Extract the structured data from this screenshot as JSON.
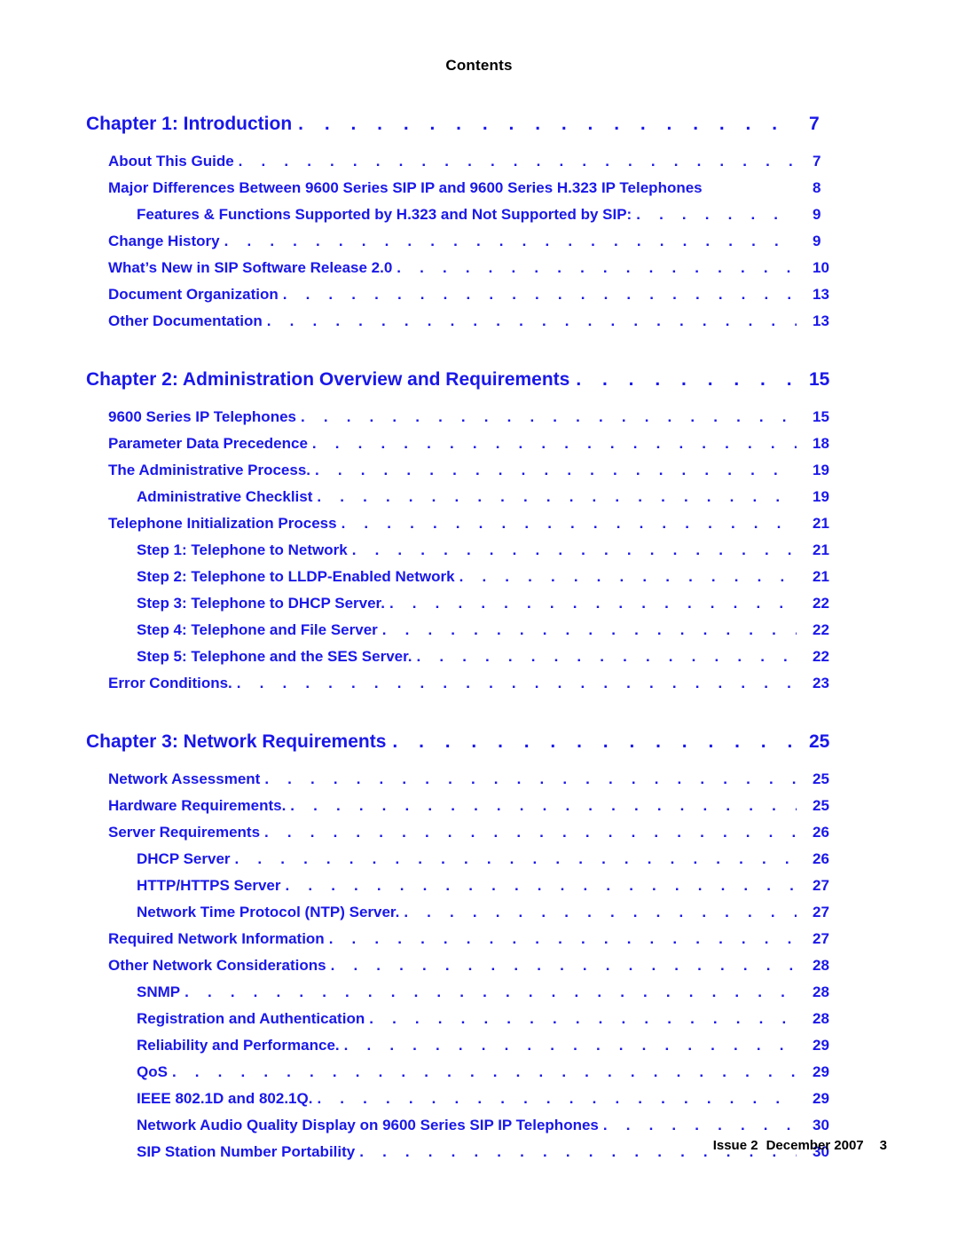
{
  "heading": "Contents",
  "footer": {
    "issue": "Issue 2",
    "date": "December 2007",
    "page": "3"
  },
  "colors": {
    "link_blue": "#1a18e8",
    "text_black": "#000000",
    "background": "#ffffff"
  },
  "toc": [
    {
      "level": "chapter",
      "label": "Chapter 1: Introduction",
      "page": "7",
      "leader": true
    },
    {
      "level": "1",
      "label": "About This Guide",
      "page": "7",
      "leader": true
    },
    {
      "level": "1",
      "label": "Major Differences Between 9600 Series SIP IP and 9600 Series H.323 IP Telephones",
      "page": "8",
      "leader": false
    },
    {
      "level": "2",
      "label": "Features & Functions Supported by H.323 and Not Supported by SIP:",
      "page": "9",
      "leader": true
    },
    {
      "level": "1",
      "label": "Change History",
      "page": "9",
      "leader": true
    },
    {
      "level": "1",
      "label": "What’s New in SIP Software Release 2.0",
      "page": "10",
      "leader": true
    },
    {
      "level": "1",
      "label": "Document Organization",
      "page": "13",
      "leader": true
    },
    {
      "level": "1",
      "label": "Other Documentation",
      "page": "13",
      "leader": true
    },
    {
      "level": "chapter",
      "label": "Chapter 2: Administration Overview and Requirements",
      "page": "15",
      "leader": true
    },
    {
      "level": "1",
      "label": "9600 Series IP Telephones",
      "page": "15",
      "leader": true
    },
    {
      "level": "1",
      "label": "Parameter Data Precedence",
      "page": "18",
      "leader": true
    },
    {
      "level": "1",
      "label": "The Administrative Process.",
      "page": "19",
      "leader": true
    },
    {
      "level": "2",
      "label": "Administrative Checklist",
      "page": "19",
      "leader": true
    },
    {
      "level": "1",
      "label": "Telephone Initialization Process",
      "page": "21",
      "leader": true
    },
    {
      "level": "2",
      "label": "Step 1: Telephone to Network",
      "page": "21",
      "leader": true
    },
    {
      "level": "2",
      "label": "Step 2: Telephone to LLDP-Enabled Network",
      "page": "21",
      "leader": true
    },
    {
      "level": "2",
      "label": "Step 3: Telephone to DHCP Server.",
      "page": "22",
      "leader": true
    },
    {
      "level": "2",
      "label": "Step 4: Telephone and File Server",
      "page": "22",
      "leader": true
    },
    {
      "level": "2",
      "label": "Step 5: Telephone and the SES Server.",
      "page": "22",
      "leader": true
    },
    {
      "level": "1",
      "label": "Error Conditions.",
      "page": "23",
      "leader": true
    },
    {
      "level": "chapter",
      "label": "Chapter 3: Network Requirements",
      "page": "25",
      "leader": true
    },
    {
      "level": "1",
      "label": "Network Assessment",
      "page": "25",
      "leader": true
    },
    {
      "level": "1",
      "label": "Hardware Requirements.",
      "page": "25",
      "leader": true
    },
    {
      "level": "1",
      "label": "Server Requirements",
      "page": "26",
      "leader": true
    },
    {
      "level": "2",
      "label": "DHCP Server",
      "page": "26",
      "leader": true
    },
    {
      "level": "2",
      "label": "HTTP/HTTPS Server",
      "page": "27",
      "leader": true
    },
    {
      "level": "2",
      "label": "Network Time Protocol (NTP) Server.",
      "page": "27",
      "leader": true
    },
    {
      "level": "1",
      "label": "Required Network Information",
      "page": "27",
      "leader": true
    },
    {
      "level": "1",
      "label": "Other Network Considerations",
      "page": "28",
      "leader": true
    },
    {
      "level": "2",
      "label": "SNMP",
      "page": "28",
      "leader": true
    },
    {
      "level": "2",
      "label": "Registration and Authentication",
      "page": "28",
      "leader": true
    },
    {
      "level": "2",
      "label": "Reliability and Performance.",
      "page": "29",
      "leader": true
    },
    {
      "level": "2",
      "label": "QoS",
      "page": "29",
      "leader": true
    },
    {
      "level": "2",
      "label": "IEEE 802.1D and 802.1Q.",
      "page": "29",
      "leader": true
    },
    {
      "level": "2",
      "label": "Network Audio Quality Display on 9600 Series SIP IP Telephones",
      "page": "30",
      "leader": true
    },
    {
      "level": "2",
      "label": "SIP Station Number Portability",
      "page": "30",
      "leader": true
    }
  ]
}
